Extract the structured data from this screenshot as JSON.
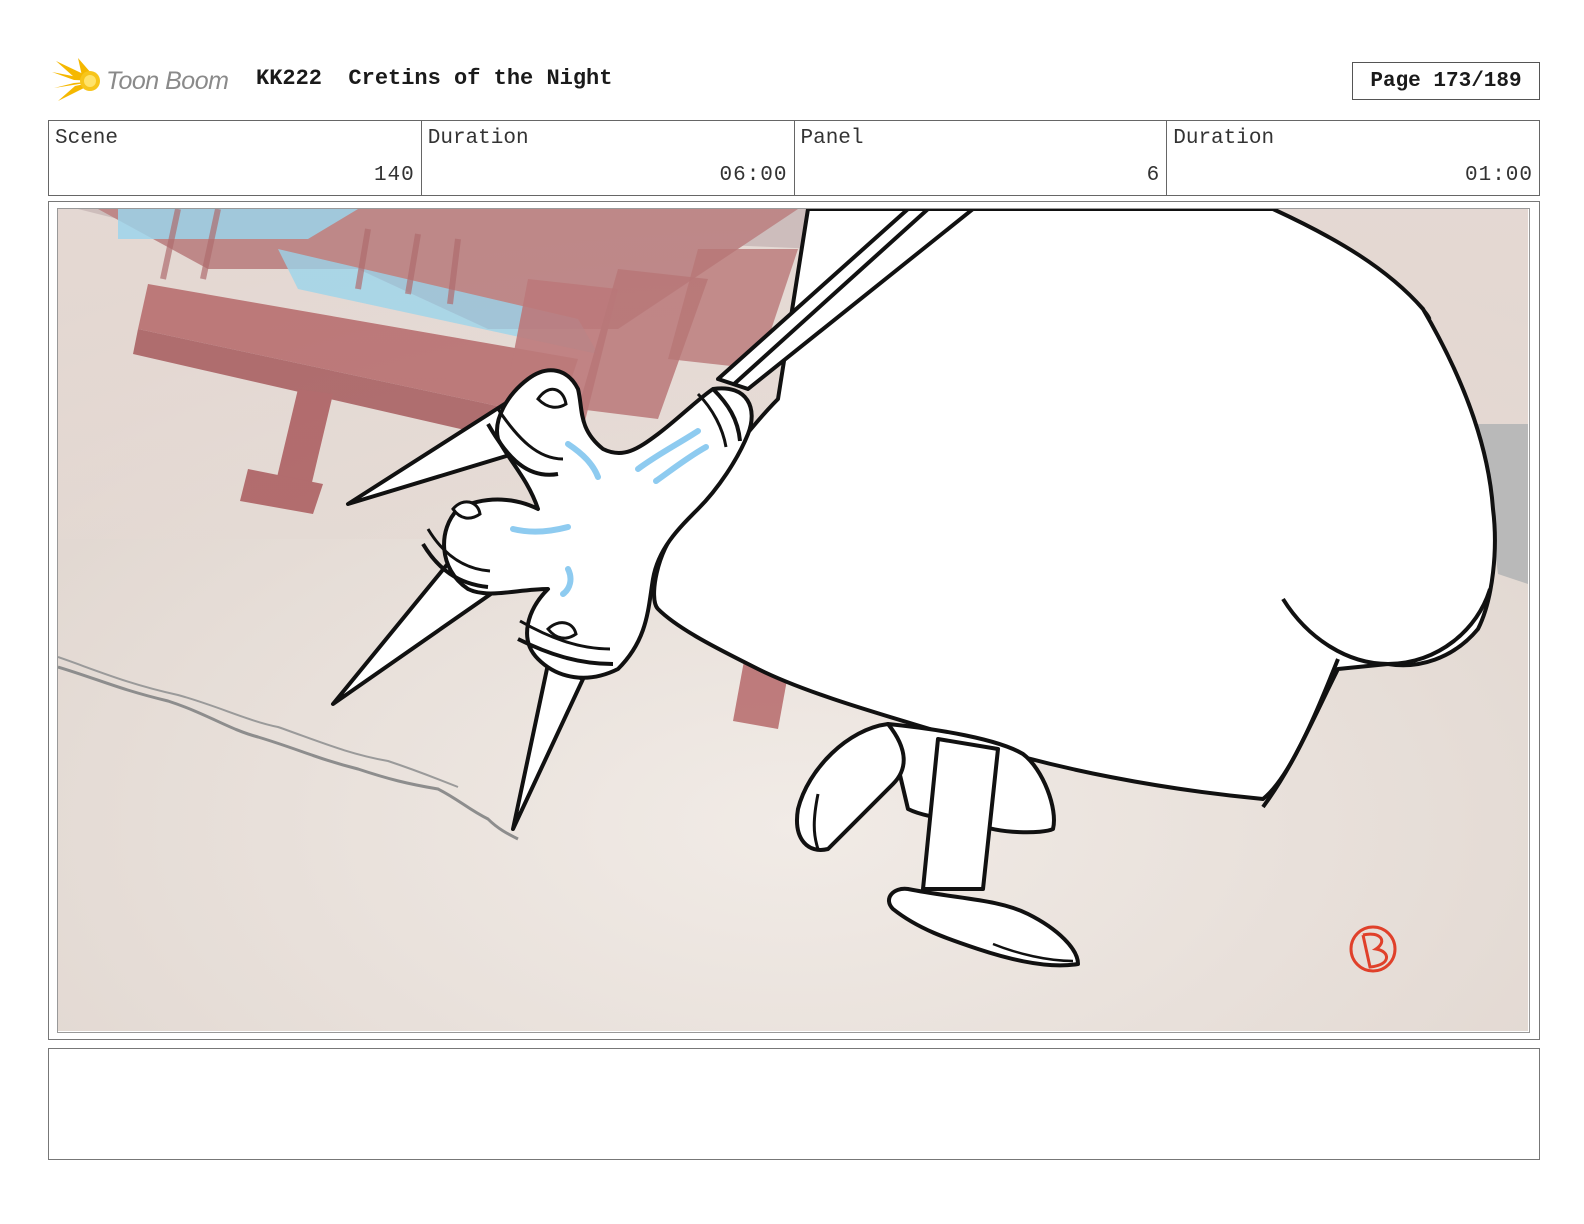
{
  "header": {
    "logo_text": "Toon Boom",
    "episode": "KK222",
    "title": "Cretins of the Night",
    "page": "Page 173/189"
  },
  "info": {
    "scene_label": "Scene",
    "scene_value": "140",
    "scene_duration_label": "Duration",
    "scene_duration_value": "06:00",
    "panel_label": "Panel",
    "panel_value": "6",
    "panel_duration_label": "Duration",
    "panel_duration_value": "01:00"
  },
  "notes": {
    "text": ""
  },
  "colors": {
    "logo_flare": "#f5b800",
    "wood": "#b5686a",
    "sky": "#8fd3ef",
    "sand": "#e6dcd5",
    "highlight": "#8ecbf0",
    "signature": "#e0402a"
  }
}
